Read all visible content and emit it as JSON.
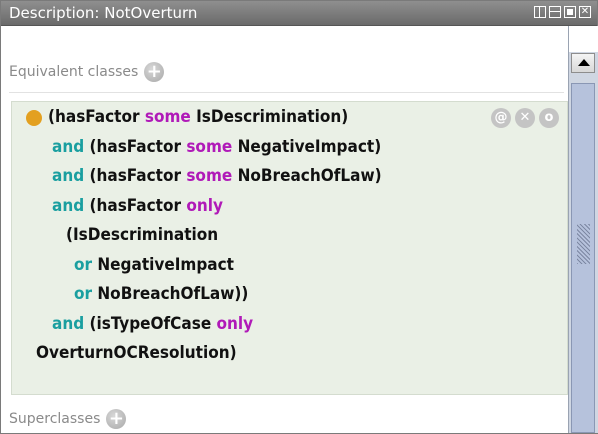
{
  "window": {
    "title": "Description: NotOverturn",
    "close_glyph": "✕"
  },
  "equivalent_classes": {
    "header": "Equivalent classes",
    "add_glyph": "+",
    "expression_lines": [
      [
        {
          "t": "(hasFactor ",
          "c": "txt"
        },
        {
          "t": "some",
          "c": "kw-some"
        },
        {
          "t": " IsDescrimination)",
          "c": "txt"
        }
      ],
      [
        {
          "t": "and",
          "c": "kw-and"
        },
        {
          "t": " (hasFactor ",
          "c": "txt"
        },
        {
          "t": "some",
          "c": "kw-some"
        },
        {
          "t": " NegativeImpact)",
          "c": "txt"
        }
      ],
      [
        {
          "t": "and",
          "c": "kw-and"
        },
        {
          "t": " (hasFactor ",
          "c": "txt"
        },
        {
          "t": "some",
          "c": "kw-some"
        },
        {
          "t": " NoBreachOfLaw)",
          "c": "txt"
        }
      ],
      [
        {
          "t": "and",
          "c": "kw-and"
        },
        {
          "t": " (hasFactor ",
          "c": "txt"
        },
        {
          "t": "only",
          "c": "kw-only"
        }
      ],
      [
        {
          "t": "(IsDescrimination",
          "c": "txt"
        }
      ],
      [
        {
          "t": "or",
          "c": "kw-or"
        },
        {
          "t": " NegativeImpact",
          "c": "txt"
        }
      ],
      [
        {
          "t": "or",
          "c": "kw-or"
        },
        {
          "t": " NoBreachOfLaw))",
          "c": "txt"
        }
      ],
      [
        {
          "t": "and",
          "c": "kw-and"
        },
        {
          "t": " (isTypeOfCase ",
          "c": "txt"
        },
        {
          "t": "only",
          "c": "kw-only"
        }
      ],
      [
        {
          "t": "OverturnOCResolution)",
          "c": "txt"
        }
      ]
    ],
    "row_controls": {
      "annotate_glyph": "@",
      "delete_glyph": "✕",
      "edit_glyph": "o"
    }
  },
  "superclasses": {
    "header": "Superclasses",
    "add_glyph": "+"
  },
  "colors": {
    "keyword_restriction": "#b01ab8",
    "keyword_logical": "#1a9fa0",
    "bullet": "#e3a020",
    "expression_background": "#eaf0e6"
  }
}
